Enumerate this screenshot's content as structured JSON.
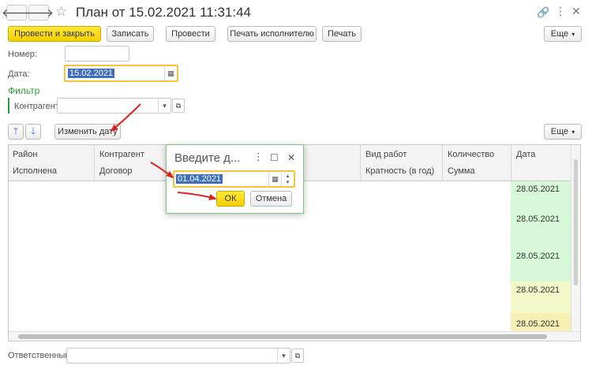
{
  "window": {
    "title": "План от 15.02.2021 11:31:44",
    "icons": [
      "back-arrow-icon",
      "forward-arrow-icon",
      "star-icon",
      "link-icon",
      "more-icon",
      "close-icon"
    ]
  },
  "toolbar": {
    "post_close": "Провести и закрыть",
    "save": "Записать",
    "post": "Провести",
    "print_executor": "Печать исполнителю",
    "print": "Печать",
    "more": "Еще"
  },
  "form": {
    "number_label": "Номер:",
    "number_value": "",
    "date_label": "Дата:",
    "date_value": "15.02.2021",
    "filter_title": "Фильтр",
    "contractor_label": "Контрагент:",
    "contractor_value": "",
    "responsible_label": "Ответственный:",
    "responsible_value": ""
  },
  "table_toolbar": {
    "change_date": "Изменить дату",
    "more": "Еще"
  },
  "table": {
    "headers_row1": [
      "Район",
      "Контрагент",
      "Вид работ",
      "Количество",
      "Дата"
    ],
    "headers_row2": [
      "Исполнена",
      "Договор",
      "Кратность (в год)",
      "Сумма"
    ],
    "dates": [
      "28.05.2021",
      "28.05.2021",
      "28.05.2021",
      "28.05.2021",
      "28.05.2021"
    ],
    "row_colors": [
      "#d8f9d8",
      "#d8f9d8",
      "#d8f9d8",
      "#f3f9c8",
      "#f7efb4"
    ]
  },
  "dialog": {
    "title": "Введите д...",
    "date_value": "01.04.2021",
    "ok": "ОК",
    "cancel": "Отмена"
  },
  "colors": {
    "accent_yellow": "#f5cf00",
    "arrow_red": "#e02020",
    "filter_green": "#2a9d3a",
    "selection_blue": "#3d6fbe"
  }
}
